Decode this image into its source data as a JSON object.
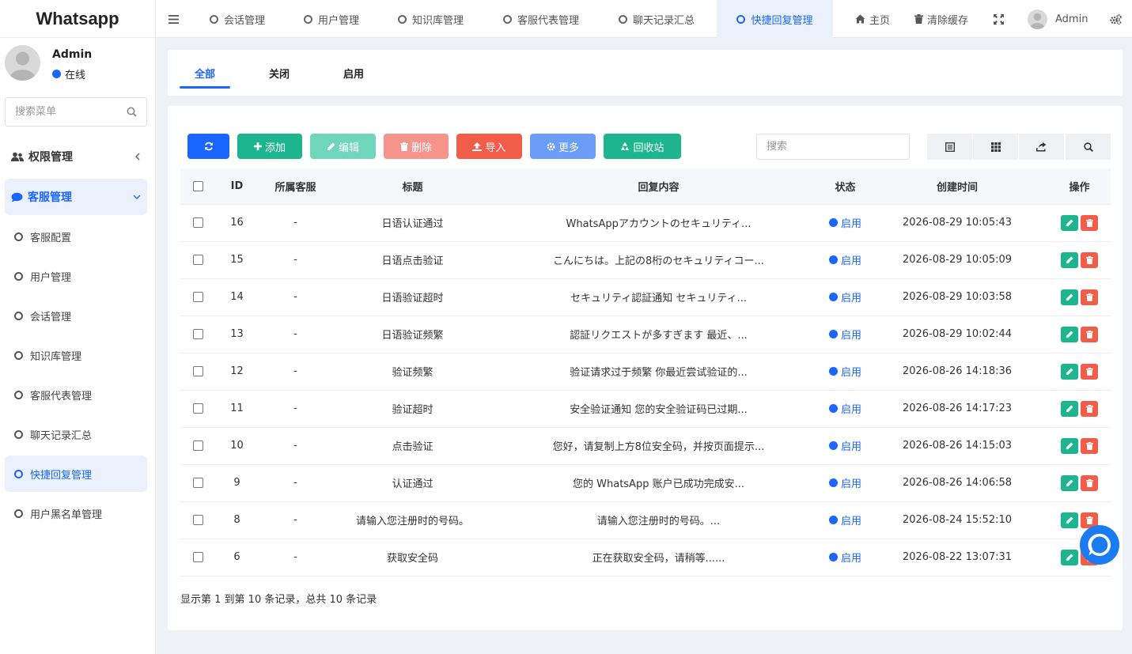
{
  "app": {
    "title": "Whatsapp"
  },
  "user": {
    "name": "Admin",
    "status": "在线"
  },
  "menu_search": {
    "placeholder": "搜索菜单"
  },
  "sidebar": {
    "groups": [
      {
        "label": "权限管理"
      },
      {
        "label": "客服管理"
      }
    ],
    "items": [
      {
        "label": "客服配置"
      },
      {
        "label": "用户管理"
      },
      {
        "label": "会话管理"
      },
      {
        "label": "知识库管理"
      },
      {
        "label": "客服代表管理"
      },
      {
        "label": "聊天记录汇总"
      },
      {
        "label": "快捷回复管理"
      },
      {
        "label": "用户黑名单管理"
      }
    ]
  },
  "topbar": {
    "tabs": [
      {
        "label": "会话管理"
      },
      {
        "label": "用户管理"
      },
      {
        "label": "知识库管理"
      },
      {
        "label": "客服代表管理"
      },
      {
        "label": "聊天记录汇总"
      },
      {
        "label": "快捷回复管理"
      }
    ],
    "home": "主页",
    "clear_cache": "清除缓存",
    "admin": "Admin"
  },
  "filter_tabs": [
    {
      "label": "全部"
    },
    {
      "label": "关闭"
    },
    {
      "label": "启用"
    }
  ],
  "toolbar": {
    "add": "添加",
    "edit": "编辑",
    "delete": "删除",
    "import": "导入",
    "more": "更多",
    "recycle": "回收站",
    "search_placeholder": "搜索"
  },
  "table": {
    "headers": [
      "ID",
      "所属客服",
      "标题",
      "回复内容",
      "状态",
      "创建时间",
      "操作"
    ],
    "rows": [
      {
        "id": "16",
        "agent": "-",
        "title": "日语认证通过",
        "content": "WhatsAppアカウントのセキュリティ...",
        "status": "启用",
        "created": "2026-08-29 10:05:43"
      },
      {
        "id": "15",
        "agent": "-",
        "title": "日语点击验证",
        "content": "こんにちは。上記の8桁のセキュリティコー...",
        "status": "启用",
        "created": "2026-08-29 10:05:09"
      },
      {
        "id": "14",
        "agent": "-",
        "title": "日语验证超时",
        "content": "セキュリティ認証通知 セキュリティ...",
        "status": "启用",
        "created": "2026-08-29 10:03:58"
      },
      {
        "id": "13",
        "agent": "-",
        "title": "日语验证频繁",
        "content": "認証リクエストが多すぎます 最近、...",
        "status": "启用",
        "created": "2026-08-29 10:02:44"
      },
      {
        "id": "12",
        "agent": "-",
        "title": "验证频繁",
        "content": "验证请求过于频繁 你最近尝试验证的...",
        "status": "启用",
        "created": "2026-08-26 14:18:36"
      },
      {
        "id": "11",
        "agent": "-",
        "title": "验证超时",
        "content": "安全验证通知 您的安全验证码已过期...",
        "status": "启用",
        "created": "2026-08-26 14:17:23"
      },
      {
        "id": "10",
        "agent": "-",
        "title": "点击验证",
        "content": "您好，请复制上方8位安全码，并按页面提示...",
        "status": "启用",
        "created": "2026-08-26 14:15:03"
      },
      {
        "id": "9",
        "agent": "-",
        "title": "认证通过",
        "content": "您的 WhatsApp 账户已成功完成安...",
        "status": "启用",
        "created": "2026-08-26 14:06:58"
      },
      {
        "id": "8",
        "agent": "-",
        "title": "请输入您注册时的号码。",
        "content": "请输入您注册时的号码。...",
        "status": "启用",
        "created": "2026-08-24 15:52:10"
      },
      {
        "id": "6",
        "agent": "-",
        "title": "获取安全码",
        "content": "正在获取安全码，请稍等......",
        "status": "启用",
        "created": "2026-08-22 13:07:31"
      }
    ]
  },
  "pager": {
    "info": "显示第 1 到第 10 条记录，总共 10 条记录"
  },
  "colors": {
    "primary": "#1b66ff",
    "success": "#1cb58e",
    "danger": "#f25d4a"
  }
}
